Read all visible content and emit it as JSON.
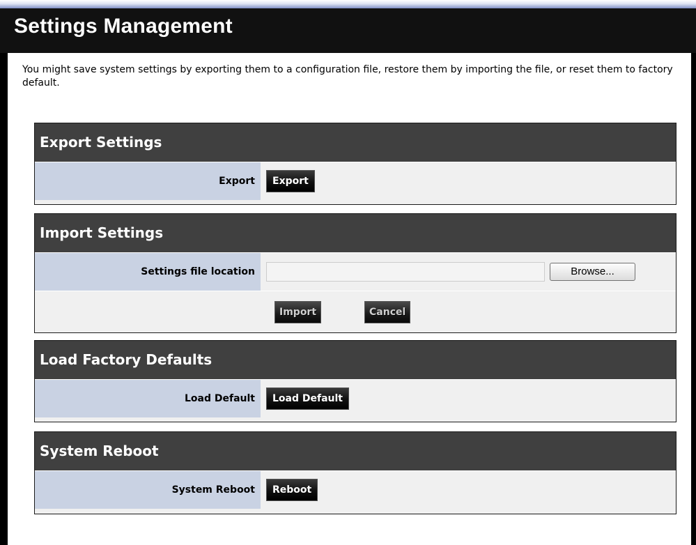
{
  "page": {
    "title": "Settings Management",
    "description": "You might save system settings by exporting them to a configuration file, restore them by importing the file, or reset them to factory default."
  },
  "export": {
    "header": "Export Settings",
    "label": "Export",
    "button": "Export"
  },
  "import": {
    "header": "Import Settings",
    "file_label": "Settings file location",
    "file_value": "",
    "browse_button": "Browse...",
    "import_button": "Import",
    "cancel_button": "Cancel"
  },
  "factory": {
    "header": "Load Factory Defaults",
    "label": "Load Default",
    "button": "Load Default"
  },
  "reboot": {
    "header": "System Reboot",
    "label": "System Reboot",
    "button": "Reboot"
  },
  "colors": {
    "header_bar": "#111111",
    "section_header": "#404040",
    "label_cell": "#c9d2e3",
    "value_cell": "#f0f0f0",
    "top_strip": "#7f8fc6"
  }
}
